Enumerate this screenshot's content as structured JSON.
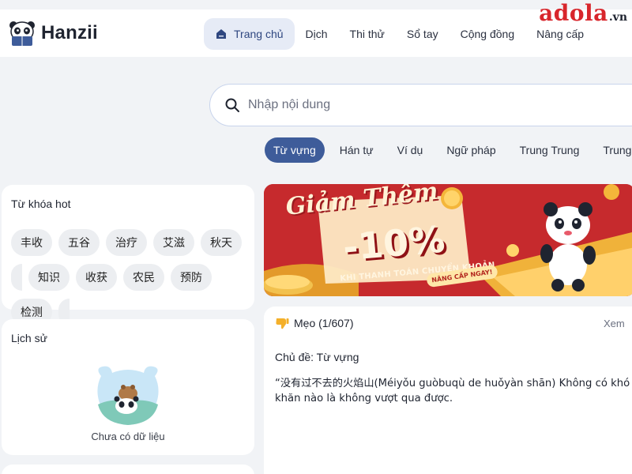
{
  "app": {
    "name": "Hanzii"
  },
  "watermark": {
    "main": "adola",
    "sub": ".vn"
  },
  "nav": {
    "items": [
      {
        "label": "Trang chủ",
        "active": true
      },
      {
        "label": "Dịch"
      },
      {
        "label": "Thi thử"
      },
      {
        "label": "Sổ tay"
      },
      {
        "label": "Cộng đồng"
      },
      {
        "label": "Nâng cấp"
      }
    ]
  },
  "search": {
    "placeholder": "Nhập nội dung"
  },
  "tabs": [
    {
      "label": "Từ vựng",
      "active": true
    },
    {
      "label": "Hán tự"
    },
    {
      "label": "Ví dụ"
    },
    {
      "label": "Ngữ pháp"
    },
    {
      "label": "Trung Trung"
    },
    {
      "label": "Trung"
    }
  ],
  "hot": {
    "title": "Từ khóa hot",
    "row1": [
      "丰收",
      "五谷",
      "治疗",
      "艾滋",
      "秋天"
    ],
    "row2": [
      "知识",
      "收获",
      "农民",
      "预防",
      "检测"
    ]
  },
  "history": {
    "title": "Lịch sử",
    "empty": "Chưa có dữ liệu"
  },
  "banner": {
    "headline": "Giảm Thêm",
    "discount": "-10%",
    "subtitle": "KHI THANH TOÁN CHUYỂN KHOẢN",
    "cta": "NÂNG CẤP NGAY!"
  },
  "tip": {
    "title": "Mẹo (1/607)",
    "more": "Xem",
    "topic": "Chủ đề: Từ vựng",
    "body": "“没有过不去的火焰山(Méiyǒu guòbuqù de huǒyàn shān) Không có khó khăn nào là không vượt qua được."
  },
  "colors": {
    "accent": "#3e5c9a",
    "nav_active_bg": "#e6ebf6",
    "banner_red": "#c8262a",
    "watermark_red": "#d8262c"
  }
}
